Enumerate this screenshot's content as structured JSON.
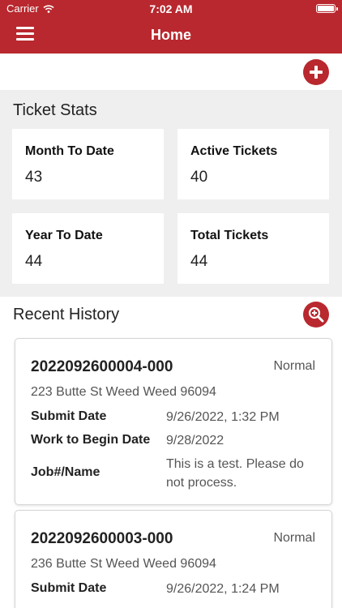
{
  "status_bar": {
    "carrier": "Carrier",
    "time": "7:02 AM"
  },
  "header": {
    "title": "Home"
  },
  "ticket_stats": {
    "title": "Ticket Stats",
    "cards": [
      {
        "label": "Month To Date",
        "value": "43"
      },
      {
        "label": "Active Tickets",
        "value": "40"
      },
      {
        "label": "Year To Date",
        "value": "44"
      },
      {
        "label": "Total Tickets",
        "value": "44"
      }
    ]
  },
  "recent_history": {
    "title": "Recent History",
    "tickets": [
      {
        "id": "2022092600004-000",
        "priority": "Normal",
        "address": "223 Butte St Weed Weed 96094",
        "submit_label": "Submit Date",
        "submit_value": "9/26/2022, 1:32 PM",
        "work_label": "Work to Begin Date",
        "work_value": "9/28/2022",
        "job_label": "Job#/Name",
        "job_value": "This is a test. Please do not process."
      },
      {
        "id": "2022092600003-000",
        "priority": "Normal",
        "address": "236 Butte St Weed Weed 96094",
        "submit_label": "Submit Date",
        "submit_value": "9/26/2022, 1:24 PM"
      }
    ]
  },
  "icons": {
    "menu": "hamburger-menu-icon",
    "add": "plus-circle-icon",
    "search": "zoom-in-icon"
  },
  "colors": {
    "brand": "#b8282e",
    "background": "#efefef",
    "card": "#ffffff"
  }
}
